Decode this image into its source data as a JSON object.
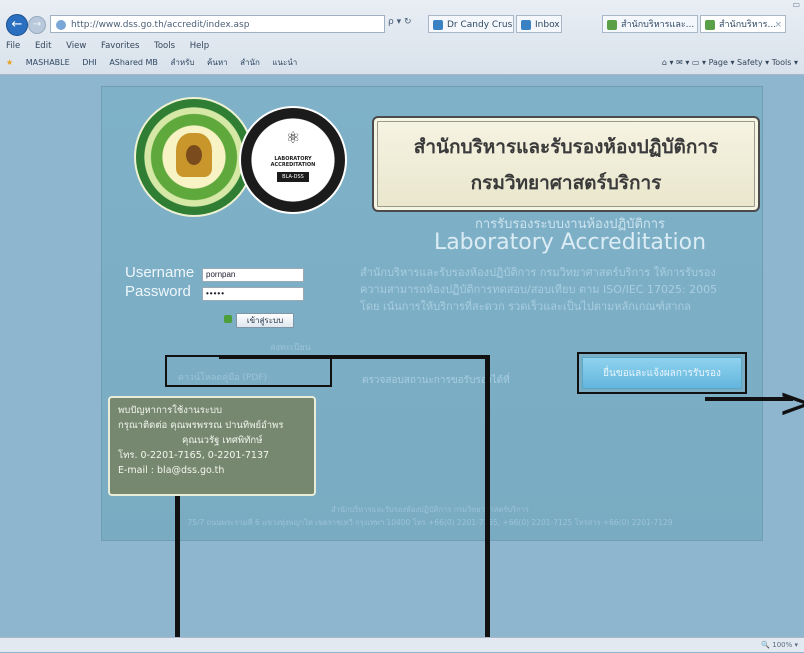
{
  "browser": {
    "address_text": "http://www.dss.go.th/accredit/index.asp",
    "search_ctrl": "ρ ▾ ↻",
    "tabs": [
      {
        "label": "Dr Candy Crush S..."
      },
      {
        "label": "Inbox"
      },
      {
        "label": "สำนักบริหารและ..."
      },
      {
        "label": "สำนักบริหาร..."
      }
    ],
    "menu": [
      "File",
      "Edit",
      "View",
      "Favorites",
      "Tools",
      "Help"
    ],
    "favorites": [
      "MASHABLE",
      "DHI",
      "AShared MB",
      "สำหรับ",
      "ค้นหา",
      "สำนัก",
      "แนะนำ"
    ],
    "toolbar_right": "⌂ ▾  ✉ ▾  ▭ ▾  Page ▾  Safety ▾  Tools ▾",
    "status_text": "🔍 100% ▾"
  },
  "header": {
    "title_line1": "สำนักบริหารและรับรองห้องปฏิบัติการ",
    "title_line2": "กรมวิทยาศาสตร์บริการ",
    "subtitle_th": "การรับรองระบบงานห้องปฏิบัติการ",
    "subtitle_en": "Laboratory Accreditation",
    "intro": "สำนักบริหารและรับรองห้องปฏิบัติการ กรมวิทยาศาสตร์บริการ ให้การรับรองความสามารถห้องปฏิบัติการทดสอบ/สอบเทียบ ตาม ISO/IEC 17025: 2005 โดย เน้นการให้บริการที่สะดวก รวดเร็วและเป็นไปตามหลักเกณฑ์สากล"
  },
  "seal2": {
    "logo_text": "LABORATORY ACCREDITATION",
    "code": "BLA-DSS"
  },
  "login": {
    "username_label": "Username",
    "password_label": "Password",
    "username_value": "pornpan",
    "password_value": "•••••",
    "login_button": "เข้าสู่ระบบ"
  },
  "links": {
    "register": "ลงทะเบียน",
    "download": "ดาวน์โหลดคู่มือ (PDF)",
    "check_status": "ตรวจสอบสถานะการขอรับรองได้ที่",
    "apply": "ยื่นขอและแจ้งผลการรับรอง"
  },
  "contact": {
    "line1": "พบปัญหาการใช้งานระบบ",
    "line2": "กรุณาติดต่อ คุณพรพรรณ ปานทิพย์อำพร",
    "line3": "คุณนวรัฐ เทศพิทักษ์",
    "line4": "โทร. 0-2201-7165, 0-2201-7137",
    "line5": "E-mail : bla@dss.go.th"
  },
  "footer": {
    "line1": "สำนักบริหารและรับรองห้องปฏิบัติการ กรมวิทยาศาสตร์บริการ",
    "line2": "75/7 ถนนพระรามที่ 6 แขวงทุ่งพญาไท เขตราชเทวี กรุงเทพฯ 10400 โทร +66(0) 2201-7165, +66(0) 2201-7125 โทรสาร +66(0) 2201-7129"
  },
  "colors": {
    "page_bg": "#8fb6cf",
    "panel_bg": "#7fb2c9",
    "contact_bg": "#768870",
    "annotation": "#111111"
  }
}
